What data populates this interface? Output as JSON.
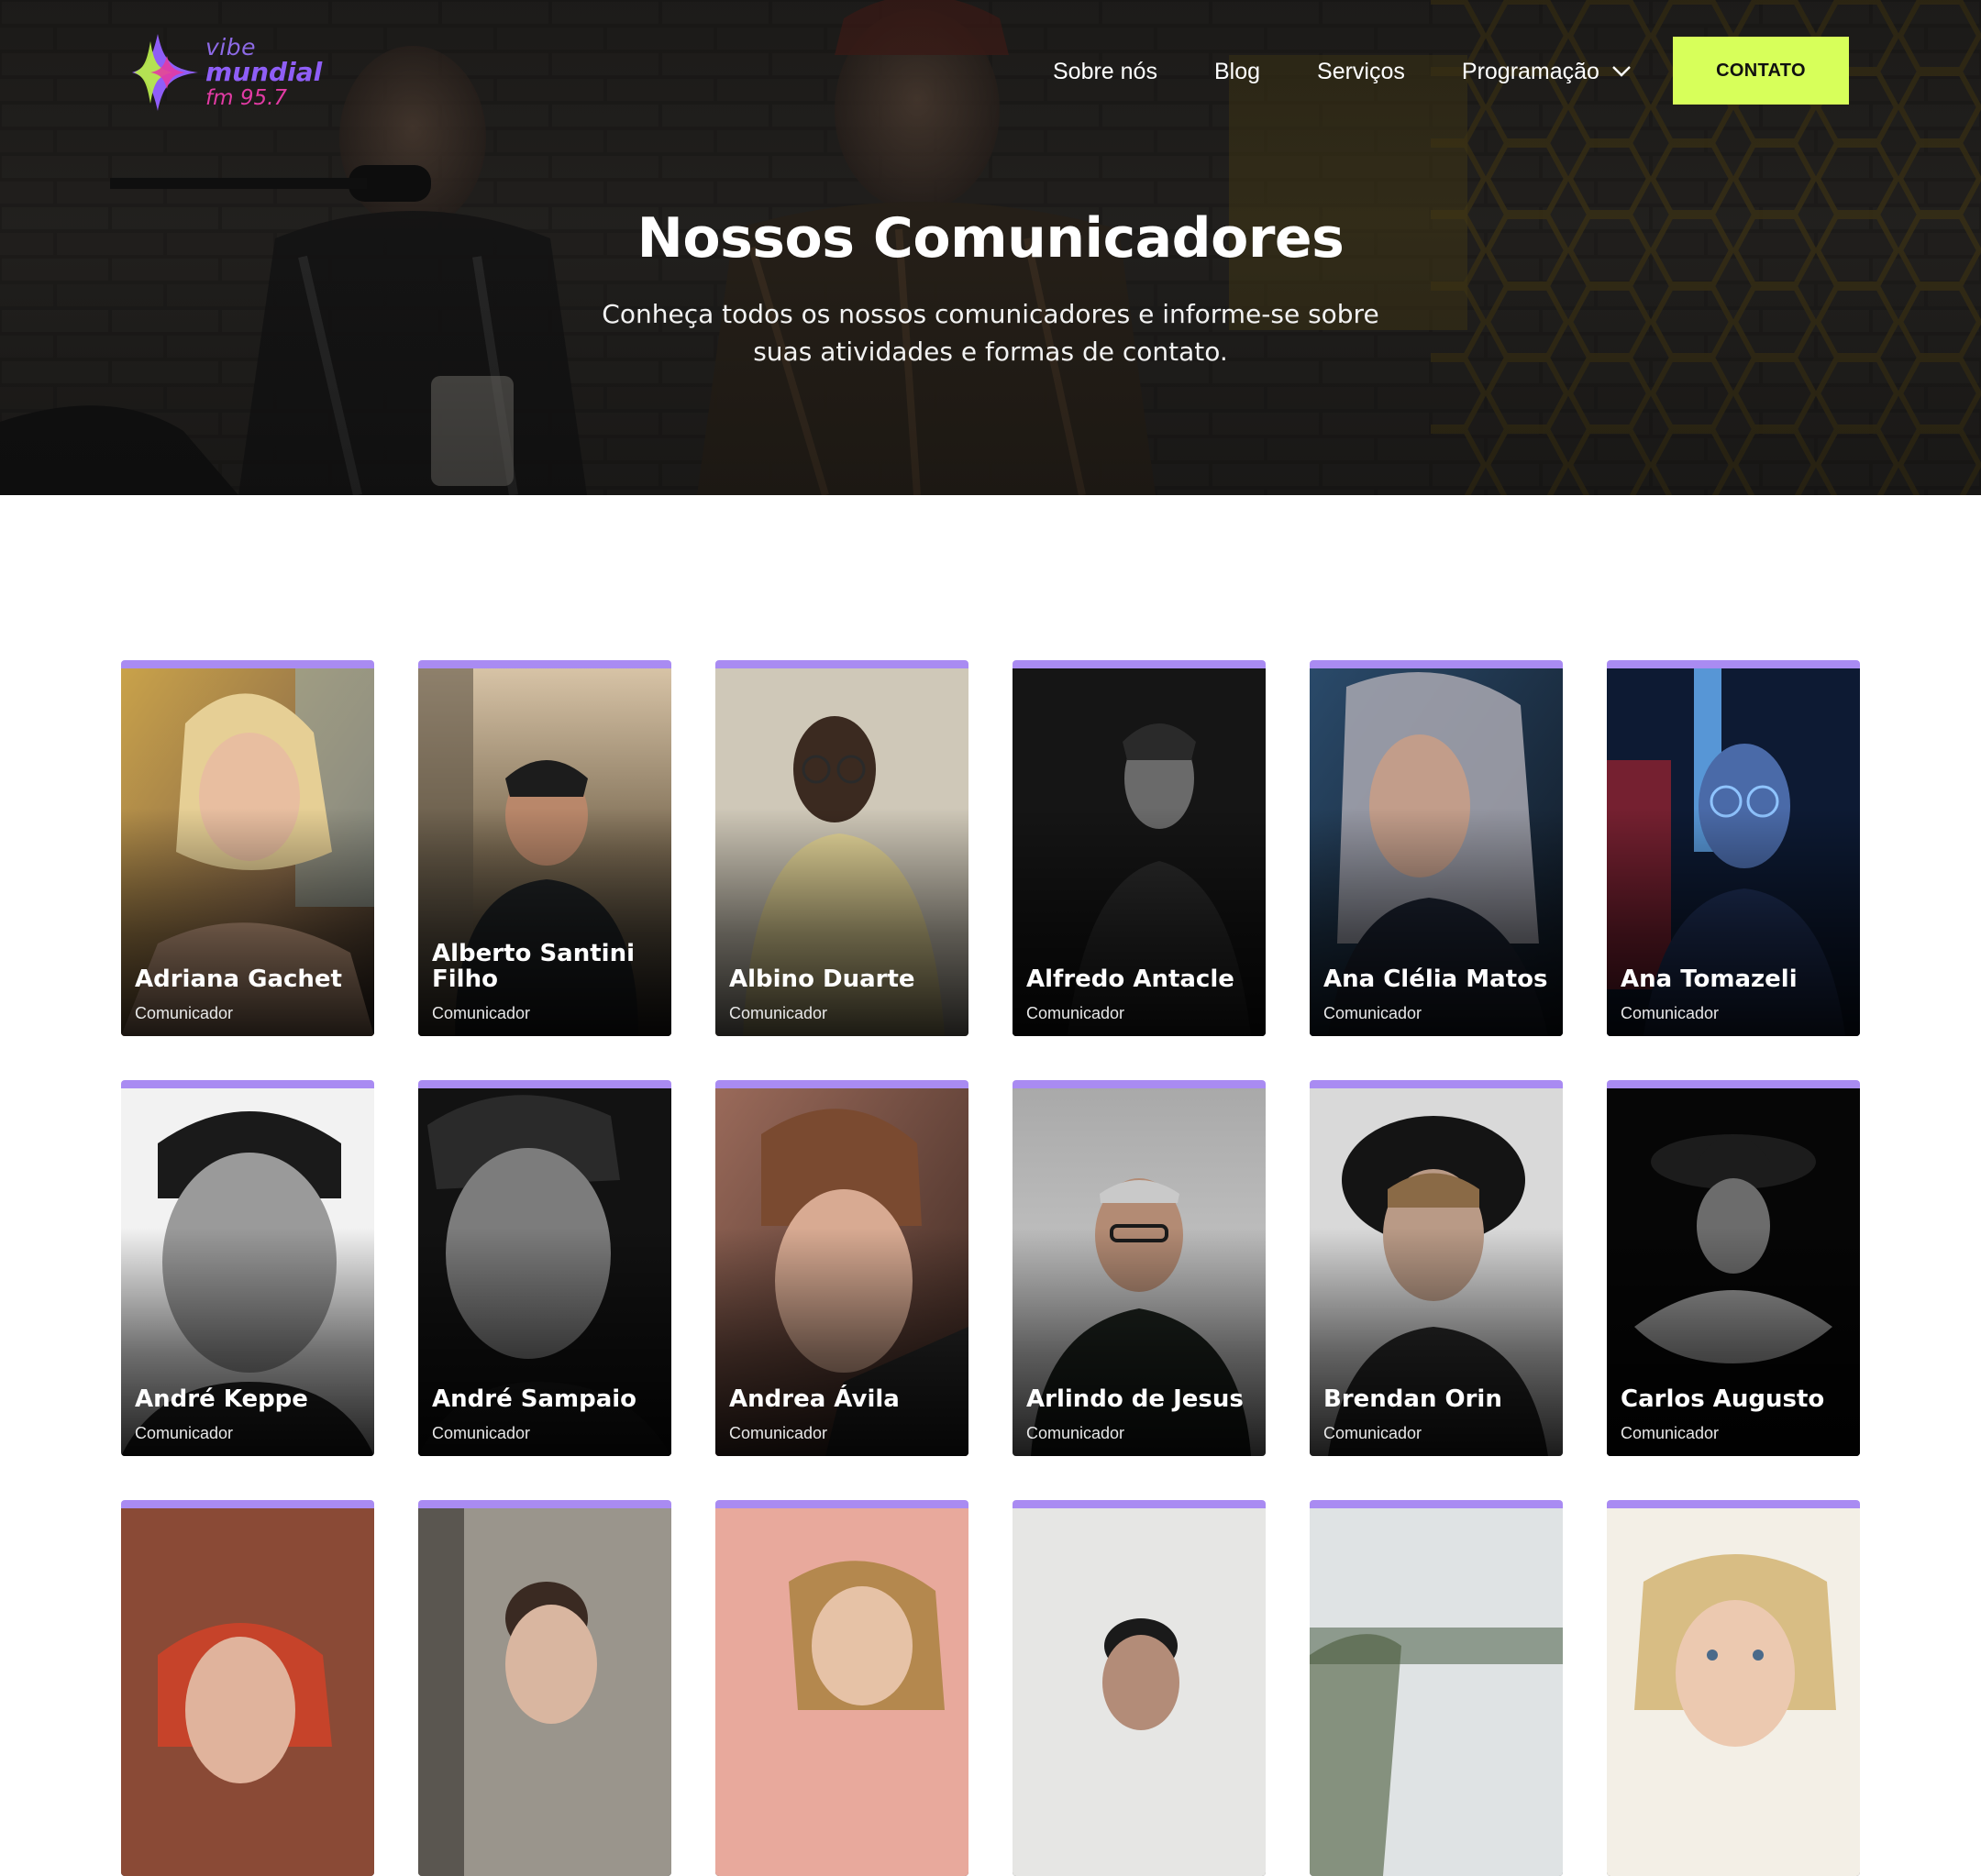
{
  "brand": {
    "line1": "vibe",
    "line2": "mundial",
    "line3": "fm 95.7"
  },
  "nav": {
    "links": [
      "Sobre nós",
      "Blog",
      "Serviços"
    ],
    "dropdown_label": "Programação",
    "cta_label": "CONTATO"
  },
  "hero": {
    "title": "Nossos Comunicadores",
    "subtitle": "Conheça todos os nossos comunicadores e informe-se sobre suas atividades e formas de contato."
  },
  "colors": {
    "accent_lime": "#d7ff5a",
    "card_top_border": "#a98bf2",
    "logo_purple": "#8f5ef7",
    "logo_pink": "#e23ba4",
    "logo_green": "#b6e94a"
  },
  "team": [
    {
      "name": "Adriana Gachet",
      "role": "Comunicador"
    },
    {
      "name": "Alberto Santini Filho",
      "role": "Comunicador"
    },
    {
      "name": "Albino Duarte",
      "role": "Comunicador"
    },
    {
      "name": "Alfredo Antacle",
      "role": "Comunicador"
    },
    {
      "name": "Ana Clélia Matos",
      "role": "Comunicador"
    },
    {
      "name": "Ana Tomazeli",
      "role": "Comunicador"
    },
    {
      "name": "André Keppe",
      "role": "Comunicador"
    },
    {
      "name": "André Sampaio",
      "role": "Comunicador"
    },
    {
      "name": "Andrea Ávila",
      "role": "Comunicador"
    },
    {
      "name": "Arlindo de Jesus",
      "role": "Comunicador"
    },
    {
      "name": "Brendan Orin",
      "role": "Comunicador"
    },
    {
      "name": "Carlos Augusto",
      "role": "Comunicador"
    },
    {
      "name": "",
      "role": ""
    },
    {
      "name": "",
      "role": ""
    },
    {
      "name": "",
      "role": ""
    },
    {
      "name": "",
      "role": ""
    },
    {
      "name": "",
      "role": ""
    },
    {
      "name": "",
      "role": ""
    }
  ]
}
